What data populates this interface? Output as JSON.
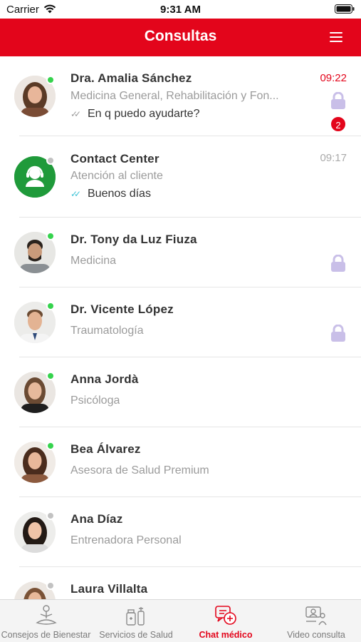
{
  "status_bar": {
    "carrier": "Carrier",
    "time": "9:31 AM"
  },
  "header": {
    "title": "Consultas",
    "menu_icon": "hamburger-menu-icon"
  },
  "colors": {
    "brand_red": "#e3051b",
    "online_green": "#35d34d",
    "offline_grey": "#c2c2c2",
    "lock_lavender": "#c9bfe8",
    "read_ticks_teal": "#3bc3d6"
  },
  "conversations": [
    {
      "name": "Dra. Amalia Sánchez",
      "subtitle": "Medicina General, Rehabilitación y Fon...",
      "message": "En q puedo ayudarte?",
      "time": "09:22",
      "unread": "2",
      "locked": true,
      "online": true
    },
    {
      "name": "Contact Center",
      "subtitle": "Atención al cliente",
      "message": "Buenos días",
      "time": "09:17",
      "locked": false,
      "online": false
    },
    {
      "name": "Dr. Tony da Luz Fiuza",
      "subtitle": "Medicina",
      "locked": true,
      "online": true
    },
    {
      "name": "Dr. Vicente López",
      "subtitle": "Traumatología",
      "locked": true,
      "online": true
    },
    {
      "name": "Anna Jordà",
      "subtitle": "Psicóloga",
      "locked": false,
      "online": true
    },
    {
      "name": "Bea Álvarez",
      "subtitle": "Asesora de Salud Premium",
      "locked": false,
      "online": true
    },
    {
      "name": "Ana Díaz",
      "subtitle": "Entrenadora Personal",
      "locked": false,
      "online": false
    },
    {
      "name": "Laura Villalta",
      "subtitle": "",
      "locked": false,
      "online": false
    }
  ],
  "tabs": [
    {
      "label": "Consejos de Bienestar",
      "icon": "meditation-icon",
      "active": false
    },
    {
      "label": "Servicios de Salud",
      "icon": "medical-supplies-icon",
      "active": false
    },
    {
      "label": "Chat médico",
      "icon": "medical-chat-icon",
      "active": true
    },
    {
      "label": "Video consulta",
      "icon": "video-consultation-icon",
      "active": false
    }
  ]
}
